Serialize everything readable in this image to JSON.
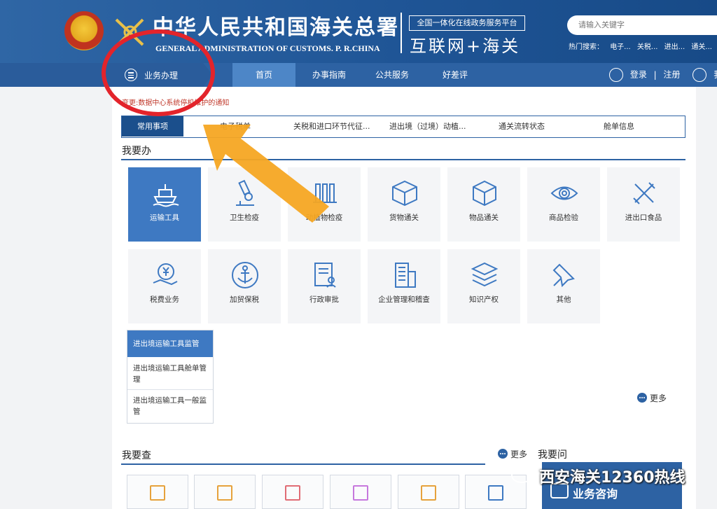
{
  "header": {
    "title_cn": "中华人民共和国海关总署",
    "title_en": "GENERAL ADMINISTRATION OF CUSTOMS. P. R.CHINA",
    "platform_label": "全国一体化在线政务服务平台",
    "platform_big": "互联网+海关",
    "search_placeholder": "请输入关键字",
    "hot_search_label": "热门搜索：",
    "hot_search_items": [
      "电子...",
      "关税...",
      "进出...",
      "通关..."
    ]
  },
  "nav": {
    "business_label": "业务办理",
    "tabs": [
      {
        "label": "首页",
        "active": true
      },
      {
        "label": "办事指南",
        "active": false
      },
      {
        "label": "公共服务",
        "active": false
      },
      {
        "label": "好差评",
        "active": false
      }
    ],
    "login_label": "登录",
    "separator": "|",
    "register_label": "注册",
    "user_label": "我"
  },
  "notice": "变更:数据中心系统停机维护的通知",
  "service_tabs": [
    {
      "label": "常用事项",
      "active": true
    },
    {
      "label": "电子税单"
    },
    {
      "label": "关税和进口环节代征..."
    },
    {
      "label": "进出境（过境）动植..."
    },
    {
      "label": "通关流转状态"
    },
    {
      "label": "舱单信息"
    }
  ],
  "section_do": {
    "title": "我要办",
    "tiles": [
      {
        "label": "运输工具",
        "icon": "ship-icon",
        "active": true
      },
      {
        "label": "卫生检疫",
        "icon": "microscope-icon"
      },
      {
        "label": "动植物检疫",
        "icon": "plant-icon"
      },
      {
        "label": "货物通关",
        "icon": "box-icon"
      },
      {
        "label": "物品通关",
        "icon": "cube-icon"
      },
      {
        "label": "商品检验",
        "icon": "eye-icon"
      },
      {
        "label": "进出口食品",
        "icon": "utensils-icon"
      },
      {
        "label": "税费业务",
        "icon": "yen-hand-icon"
      },
      {
        "label": "加贸保税",
        "icon": "anchor-icon"
      },
      {
        "label": "行政审批",
        "icon": "document-user-icon"
      },
      {
        "label": "企业管理和稽查",
        "icon": "building-icon"
      },
      {
        "label": "知识产权",
        "icon": "layers-icon"
      },
      {
        "label": "其他",
        "icon": "pin-icon"
      }
    ],
    "sub_list": {
      "header": "进出境运输工具监管",
      "items": [
        "进出境运输工具舱单管理",
        "进出境运输工具一般监管"
      ]
    },
    "more_label": "更多"
  },
  "section_check": {
    "title": "我要查",
    "more_label": "更多"
  },
  "section_ask": {
    "title": "我要问"
  },
  "watermark": "西安海关12360热线",
  "ad_text": "业务咨询",
  "colors": {
    "header_blue": "#1f5596",
    "nav_blue": "#2d62a3",
    "active_tile": "#3e79c2",
    "annotation_red": "#e3242b",
    "annotation_arrow": "#f5a623",
    "notice_red": "#c0392b"
  }
}
